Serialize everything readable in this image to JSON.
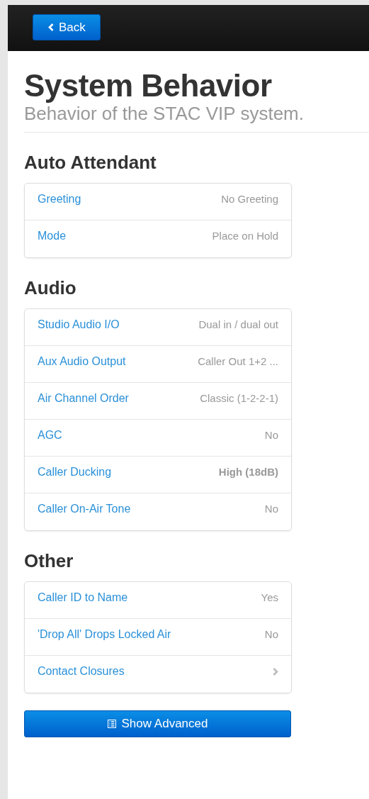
{
  "nav": {
    "back_button": "Back"
  },
  "header": {
    "title": "System Behavior",
    "subtitle": "Behavior of the STAC VIP system."
  },
  "sections": [
    {
      "heading": "Auto Attendant",
      "rows": [
        {
          "label": "Greeting",
          "kind": "text",
          "value": "No Greeting"
        },
        {
          "label": "Mode",
          "kind": "text",
          "value": "Place on Hold"
        }
      ]
    },
    {
      "heading": "Audio",
      "rows": [
        {
          "label": "Studio Audio I/O",
          "kind": "text",
          "value": "Dual in / dual out"
        },
        {
          "label": "Aux Audio Output",
          "kind": "text",
          "value": "Caller Out 1+2 ..."
        },
        {
          "label": "Air Channel Order",
          "kind": "text",
          "value": "Classic (1-2-2-1)"
        },
        {
          "label": "AGC",
          "kind": "text",
          "value": "No"
        },
        {
          "label": "Caller Ducking",
          "kind": "bold_text",
          "value": "High (18dB)"
        },
        {
          "label": "Caller On-Air Tone",
          "kind": "text",
          "value": "No"
        }
      ]
    },
    {
      "heading": "Other",
      "rows": [
        {
          "label": "Caller ID to Name",
          "kind": "text",
          "value": "Yes"
        },
        {
          "label": "'Drop All' Drops Locked Air",
          "kind": "text",
          "value": "No"
        },
        {
          "label": "Contact Closures",
          "kind": "chevron"
        }
      ]
    }
  ],
  "advanced_button": "Show Advanced"
}
